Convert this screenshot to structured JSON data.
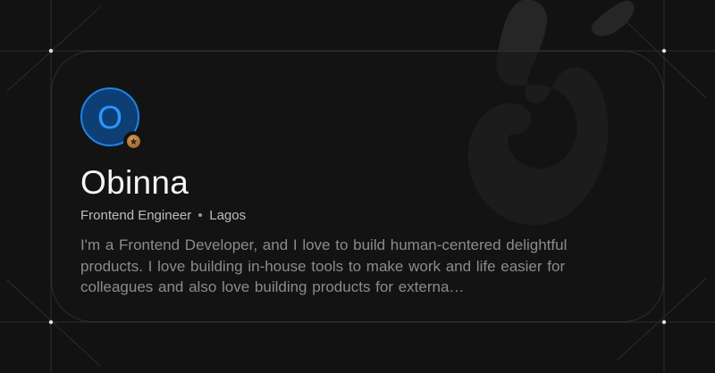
{
  "profile": {
    "initial": "O",
    "name": "Obinna",
    "role": "Frontend Engineer",
    "location": "Lagos",
    "bio": "I'm a Frontend Developer, and I love to build human-centered delightful products. I love building in-house tools to make work and life easier for colleagues and also love building products for externa…",
    "badge_icon": "star-icon"
  },
  "colors": {
    "background": "#121212",
    "avatar_fill": "#0d3e74",
    "avatar_ring": "#1d83e8",
    "avatar_text": "#2b97ff",
    "badge": "#a06a2a",
    "name_text": "#f4f4f4",
    "bio_text": "#8b8b8b"
  }
}
